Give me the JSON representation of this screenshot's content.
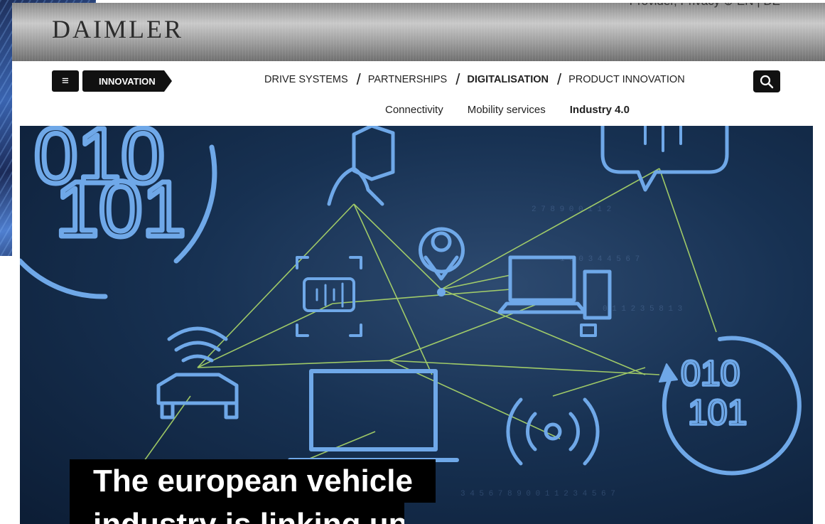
{
  "brand": {
    "logo": "DAIMLER"
  },
  "utility": {
    "text": "Provider, Privacy ⊕     EN | DE"
  },
  "nav": {
    "menu_icon": "hamburger-icon",
    "breadcrumb": "INNOVATION",
    "main_items": [
      "DRIVE SYSTEMS",
      "PARTNERSHIPS",
      "DIGITALISATION",
      "PRODUCT INNOVATION"
    ],
    "separator": "/",
    "active_main": "DIGITALISATION",
    "sub_items": [
      "Connectivity",
      "Mobility services",
      "Industry 4.0"
    ],
    "active_sub": "Industry 4.0",
    "search_icon": "search-icon"
  },
  "hero": {
    "binary_top": [
      "010",
      "101"
    ],
    "binary_right": [
      "010",
      "101"
    ],
    "icons": [
      "binary-cycle-icon",
      "smartphone-hand-icon",
      "speech-bubble-icon",
      "location-pin-icon",
      "voice-assistant-icon",
      "desktop-computer-icon",
      "connected-car-icon",
      "laptop-icon",
      "wireless-signal-icon"
    ],
    "headline_line1": "The european vehicle",
    "headline_line2": "industry is linking up"
  },
  "colors": {
    "accent_blue": "#6fa8e8",
    "network_green": "#b6e36a",
    "hero_dark": "#0c1d35"
  }
}
